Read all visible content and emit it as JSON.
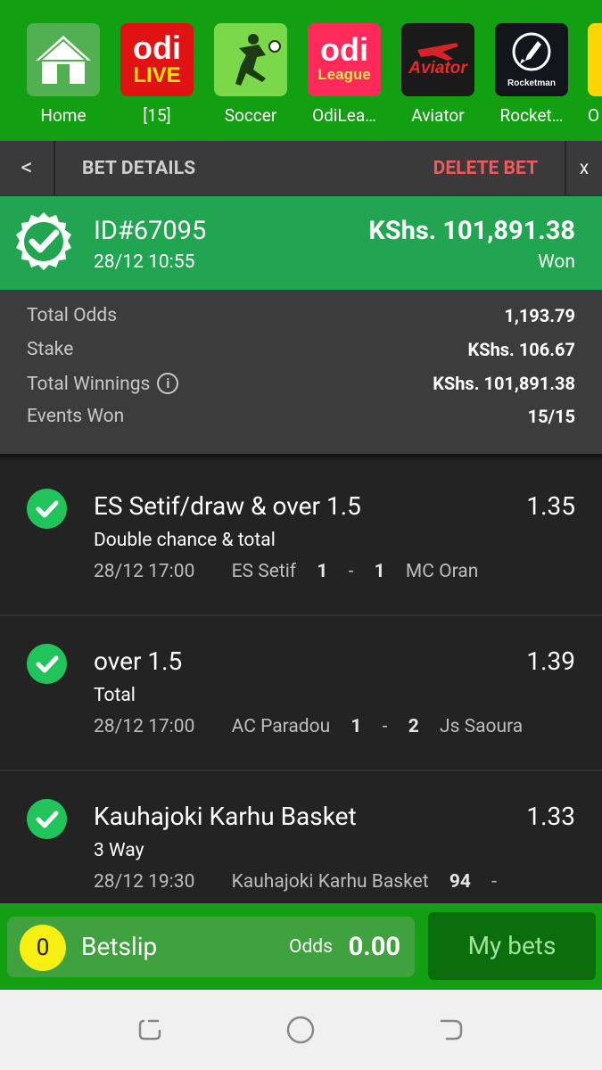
{
  "apps": [
    {
      "label": "Home",
      "icon": "home-icon"
    },
    {
      "label": "[15]",
      "icon": "odi-live-logo",
      "logo_lines": [
        "odi",
        "LIVE"
      ]
    },
    {
      "label": "Soccer",
      "icon": "soccer-player-icon"
    },
    {
      "label": "OdiLea…",
      "icon": "odi-league-logo",
      "logo_lines": [
        "odi",
        "League"
      ]
    },
    {
      "label": "Aviator",
      "icon": "aviator-logo",
      "logo_lines": [
        "Aviator"
      ]
    },
    {
      "label": "Rocket…",
      "icon": "rocketman-logo",
      "logo_lines": [
        "Rocketman"
      ]
    },
    {
      "label": "O",
      "icon": "partial-app-icon"
    }
  ],
  "header": {
    "back": "<",
    "title": "BET DETAILS",
    "delete": "DELETE BET",
    "close": "x"
  },
  "bet": {
    "id": "ID#67095",
    "date": "28/12 10:55",
    "amount": "KShs. 101,891.38",
    "status": "Won"
  },
  "summary": [
    {
      "key": "Total Odds",
      "value": "1,193.79"
    },
    {
      "key": "Stake",
      "value": "KShs. 106.67"
    },
    {
      "key": "Total Winnings",
      "value": "KShs. 101,891.38",
      "info": true
    },
    {
      "key": "Events Won",
      "value": "15/15"
    }
  ],
  "events": [
    {
      "pick": "ES Setif/draw & over 1.5",
      "odds": "1.35",
      "market": "Double chance & total",
      "datetime": "28/12 17:00",
      "home": "ES Setif",
      "home_score": "1",
      "sep": "-",
      "away_score": "1",
      "away": "MC Oran"
    },
    {
      "pick": "over 1.5",
      "odds": "1.39",
      "market": "Total",
      "datetime": "28/12 17:00",
      "home": "AC Paradou",
      "home_score": "1",
      "sep": "-",
      "away_score": "2",
      "away": "Js Saoura"
    },
    {
      "pick": "Kauhajoki Karhu Basket",
      "odds": "1.33",
      "market": "3 Way",
      "datetime": "28/12 19:30",
      "home": "Kauhajoki Karhu Basket",
      "home_score": "94",
      "sep": "-",
      "away_score": "",
      "away": ""
    }
  ],
  "betslip": {
    "count": "0",
    "label": "Betslip",
    "odds_label": "Odds",
    "odds_value": "0.00"
  },
  "mybets": "My bets",
  "colors": {
    "brand_green": "#12a012",
    "won_green": "#21a550",
    "delete_red": "#f05a5a",
    "check_green": "#21c45a",
    "betslip_yellow": "#f7ee12"
  }
}
